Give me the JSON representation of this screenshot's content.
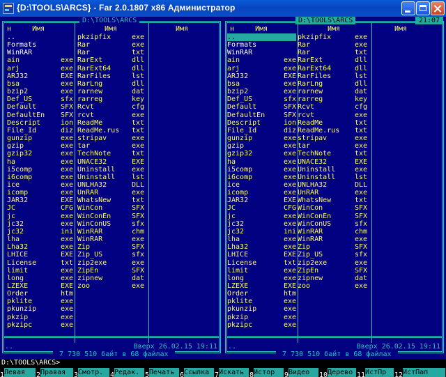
{
  "window": {
    "title": "{D:\\TOOLS\\ARCS} - Far 2.0.1807 x86 Администратор"
  },
  "clock": "21:07",
  "left_panel": {
    "path": " D:\\TOOLS\\ARCS ",
    "col1_header": "н     Имя",
    "col2_header": "Имя",
    "col3_header": "Имя",
    "status_name": "..",
    "status_info": "Вверх 26.02.15 19:11",
    "totals": " 7 730 510 байт в 68 файлах ",
    "columns": [
      [
        {
          "n": "..",
          "e": "",
          "t": "dir"
        },
        {
          "n": "Formats",
          "e": "",
          "t": "dir"
        },
        {
          "n": "WinRAR",
          "e": "",
          "t": "dir"
        },
        {
          "n": "ain",
          "e": "exe",
          "t": "f"
        },
        {
          "n": "arj",
          "e": "exe",
          "t": "f"
        },
        {
          "n": "ARJ32",
          "e": "EXE",
          "t": "f"
        },
        {
          "n": "bsa",
          "e": "exe",
          "t": "f"
        },
        {
          "n": "bzip2",
          "e": "exe",
          "t": "f"
        },
        {
          "n": "Def_US",
          "e": "sfx",
          "t": "f"
        },
        {
          "n": "Default",
          "e": "SFX",
          "t": "f"
        },
        {
          "n": "DefaultEn",
          "e": "SFX",
          "t": "f"
        },
        {
          "n": "Descript",
          "e": "ion",
          "t": "f"
        },
        {
          "n": "File_Id",
          "e": "diz",
          "t": "f"
        },
        {
          "n": "gunzip",
          "e": "exe",
          "t": "f"
        },
        {
          "n": "gzip",
          "e": "exe",
          "t": "f"
        },
        {
          "n": "gzip32",
          "e": "exe",
          "t": "f"
        },
        {
          "n": "ha",
          "e": "exe",
          "t": "f"
        },
        {
          "n": "i5comp",
          "e": "exe",
          "t": "f"
        },
        {
          "n": "i6comp",
          "e": "exe",
          "t": "f"
        },
        {
          "n": "ice",
          "e": "exe",
          "t": "f"
        },
        {
          "n": "icomp",
          "e": "exe",
          "t": "f"
        },
        {
          "n": "JAR32",
          "e": "EXE",
          "t": "f"
        },
        {
          "n": "JC",
          "e": "CFG",
          "t": "f"
        },
        {
          "n": "jc",
          "e": "exe",
          "t": "f"
        },
        {
          "n": "jc32",
          "e": "exe",
          "t": "f"
        },
        {
          "n": "jc32",
          "e": "ini",
          "t": "f"
        },
        {
          "n": "lha",
          "e": "exe",
          "t": "f"
        },
        {
          "n": "Lha32",
          "e": "exe",
          "t": "f"
        },
        {
          "n": "LHICE",
          "e": "EXE",
          "t": "f"
        },
        {
          "n": "License",
          "e": "txt",
          "t": "f"
        },
        {
          "n": "limit",
          "e": "exe",
          "t": "f"
        },
        {
          "n": "long",
          "e": "exe",
          "t": "f"
        },
        {
          "n": "LZEXE",
          "e": "EXE",
          "t": "f"
        },
        {
          "n": "Order",
          "e": "htm",
          "t": "f"
        },
        {
          "n": "pklite",
          "e": "exe",
          "t": "f"
        },
        {
          "n": "pkunzip",
          "e": "exe",
          "t": "f"
        },
        {
          "n": "pkzip",
          "e": "exe",
          "t": "f"
        },
        {
          "n": "pkzipc",
          "e": "exe",
          "t": "f"
        }
      ],
      [
        {
          "n": "pkzipfix",
          "e": "exe",
          "t": "f"
        },
        {
          "n": "Rar",
          "e": "exe",
          "t": "f"
        },
        {
          "n": "Rar",
          "e": "txt",
          "t": "f"
        },
        {
          "n": "RarExt",
          "e": "dll",
          "t": "f"
        },
        {
          "n": "RarExt64",
          "e": "dll",
          "t": "f"
        },
        {
          "n": "RarFiles",
          "e": "lst",
          "t": "f"
        },
        {
          "n": "RarLng",
          "e": "dll",
          "t": "f"
        },
        {
          "n": "rarnew",
          "e": "dat",
          "t": "f"
        },
        {
          "n": "rarreg",
          "e": "key",
          "t": "f"
        },
        {
          "n": "Rcvt",
          "e": "cfg",
          "t": "f"
        },
        {
          "n": "rcvt",
          "e": "exe",
          "t": "f"
        },
        {
          "n": "ReadMe",
          "e": "txt",
          "t": "f"
        },
        {
          "n": "ReadMe.rus",
          "e": "txt",
          "t": "f"
        },
        {
          "n": "stripav",
          "e": "exe",
          "t": "f"
        },
        {
          "n": "tar",
          "e": "exe",
          "t": "f"
        },
        {
          "n": "TechNote",
          "e": "txt",
          "t": "f"
        },
        {
          "n": "UNACE32",
          "e": "EXE",
          "t": "f"
        },
        {
          "n": "Uninstall",
          "e": "exe",
          "t": "f"
        },
        {
          "n": "Uninstall",
          "e": "lst",
          "t": "f"
        },
        {
          "n": "UNLHA32",
          "e": "DLL",
          "t": "f"
        },
        {
          "n": "UnRAR",
          "e": "exe",
          "t": "f"
        },
        {
          "n": "WhatsNew",
          "e": "txt",
          "t": "f"
        },
        {
          "n": "WinCon",
          "e": "SFX",
          "t": "f"
        },
        {
          "n": "WinConEn",
          "e": "SFX",
          "t": "f"
        },
        {
          "n": "WinConUS",
          "e": "sfx",
          "t": "f"
        },
        {
          "n": "WinRAR",
          "e": "chm",
          "t": "f"
        },
        {
          "n": "WinRAR",
          "e": "exe",
          "t": "f"
        },
        {
          "n": "Zip",
          "e": "SFX",
          "t": "f"
        },
        {
          "n": "Zip_US",
          "e": "sfx",
          "t": "f"
        },
        {
          "n": "zip2exe",
          "e": "exe",
          "t": "f"
        },
        {
          "n": "ZipEn",
          "e": "SFX",
          "t": "f"
        },
        {
          "n": "zipnew",
          "e": "dat",
          "t": "f"
        },
        {
          "n": "zoo",
          "e": "exe",
          "t": "f"
        }
      ],
      []
    ]
  },
  "right_panel": {
    "path": " D:\\TOOLS\\ARCS ",
    "col1_header": "н     Имя",
    "col2_header": "Имя",
    "col3_header": "Имя",
    "status_name": "..",
    "status_info": "Вверх 26.02.15 19:11",
    "totals": " 7 730 510 байт в 68 файлах ",
    "columns": [
      [
        {
          "n": "..",
          "e": "",
          "t": "cursor"
        },
        {
          "n": "Formats",
          "e": "",
          "t": "dir"
        },
        {
          "n": "WinRAR",
          "e": "",
          "t": "dir"
        },
        {
          "n": "ain",
          "e": "exe",
          "t": "f"
        },
        {
          "n": "arj",
          "e": "exe",
          "t": "f"
        },
        {
          "n": "ARJ32",
          "e": "EXE",
          "t": "f"
        },
        {
          "n": "bsa",
          "e": "exe",
          "t": "f"
        },
        {
          "n": "bzip2",
          "e": "exe",
          "t": "f"
        },
        {
          "n": "Def_US",
          "e": "sfx",
          "t": "f"
        },
        {
          "n": "Default",
          "e": "SFX",
          "t": "f"
        },
        {
          "n": "DefaultEn",
          "e": "SFX",
          "t": "f"
        },
        {
          "n": "Descript",
          "e": "ion",
          "t": "f"
        },
        {
          "n": "File_Id",
          "e": "diz",
          "t": "f"
        },
        {
          "n": "gunzip",
          "e": "exe",
          "t": "f"
        },
        {
          "n": "gzip",
          "e": "exe",
          "t": "f"
        },
        {
          "n": "gzip32",
          "e": "exe",
          "t": "f"
        },
        {
          "n": "ha",
          "e": "exe",
          "t": "f"
        },
        {
          "n": "i5comp",
          "e": "exe",
          "t": "f"
        },
        {
          "n": "i6comp",
          "e": "exe",
          "t": "f"
        },
        {
          "n": "ice",
          "e": "exe",
          "t": "f"
        },
        {
          "n": "icomp",
          "e": "exe",
          "t": "f"
        },
        {
          "n": "JAR32",
          "e": "EXE",
          "t": "f"
        },
        {
          "n": "JC",
          "e": "CFG",
          "t": "f"
        },
        {
          "n": "jc",
          "e": "exe",
          "t": "f"
        },
        {
          "n": "jc32",
          "e": "exe",
          "t": "f"
        },
        {
          "n": "jc32",
          "e": "ini",
          "t": "f"
        },
        {
          "n": "lha",
          "e": "exe",
          "t": "f"
        },
        {
          "n": "Lha32",
          "e": "exe",
          "t": "f"
        },
        {
          "n": "LHICE",
          "e": "EXE",
          "t": "f"
        },
        {
          "n": "License",
          "e": "txt",
          "t": "f"
        },
        {
          "n": "limit",
          "e": "exe",
          "t": "f"
        },
        {
          "n": "long",
          "e": "exe",
          "t": "f"
        },
        {
          "n": "LZEXE",
          "e": "EXE",
          "t": "f"
        },
        {
          "n": "Order",
          "e": "htm",
          "t": "f"
        },
        {
          "n": "pklite",
          "e": "exe",
          "t": "f"
        },
        {
          "n": "pkunzip",
          "e": "exe",
          "t": "f"
        },
        {
          "n": "pkzip",
          "e": "exe",
          "t": "f"
        },
        {
          "n": "pkzipc",
          "e": "exe",
          "t": "f"
        }
      ],
      [
        {
          "n": "pkzipfix",
          "e": "exe",
          "t": "f"
        },
        {
          "n": "Rar",
          "e": "exe",
          "t": "f"
        },
        {
          "n": "Rar",
          "e": "txt",
          "t": "f"
        },
        {
          "n": "RarExt",
          "e": "dll",
          "t": "f"
        },
        {
          "n": "RarExt64",
          "e": "dll",
          "t": "f"
        },
        {
          "n": "RarFiles",
          "e": "lst",
          "t": "f"
        },
        {
          "n": "RarLng",
          "e": "dll",
          "t": "f"
        },
        {
          "n": "rarnew",
          "e": "dat",
          "t": "f"
        },
        {
          "n": "rarreg",
          "e": "key",
          "t": "f"
        },
        {
          "n": "Rcvt",
          "e": "cfg",
          "t": "f"
        },
        {
          "n": "rcvt",
          "e": "exe",
          "t": "f"
        },
        {
          "n": "ReadMe",
          "e": "txt",
          "t": "f"
        },
        {
          "n": "ReadMe.rus",
          "e": "txt",
          "t": "f"
        },
        {
          "n": "stripav",
          "e": "exe",
          "t": "f"
        },
        {
          "n": "tar",
          "e": "exe",
          "t": "f"
        },
        {
          "n": "TechNote",
          "e": "txt",
          "t": "f"
        },
        {
          "n": "UNACE32",
          "e": "EXE",
          "t": "f"
        },
        {
          "n": "Uninstall",
          "e": "exe",
          "t": "f"
        },
        {
          "n": "Uninstall",
          "e": "lst",
          "t": "f"
        },
        {
          "n": "UNLHA32",
          "e": "DLL",
          "t": "f"
        },
        {
          "n": "UnRAR",
          "e": "exe",
          "t": "f"
        },
        {
          "n": "WhatsNew",
          "e": "txt",
          "t": "f"
        },
        {
          "n": "WinCon",
          "e": "SFX",
          "t": "f"
        },
        {
          "n": "WinConEn",
          "e": "SFX",
          "t": "f"
        },
        {
          "n": "WinConUS",
          "e": "sfx",
          "t": "f"
        },
        {
          "n": "WinRAR",
          "e": "chm",
          "t": "f"
        },
        {
          "n": "WinRAR",
          "e": "exe",
          "t": "f"
        },
        {
          "n": "Zip",
          "e": "SFX",
          "t": "f"
        },
        {
          "n": "Zip_US",
          "e": "sfx",
          "t": "f"
        },
        {
          "n": "zip2exe",
          "e": "exe",
          "t": "f"
        },
        {
          "n": "ZipEn",
          "e": "SFX",
          "t": "f"
        },
        {
          "n": "zipnew",
          "e": "dat",
          "t": "f"
        },
        {
          "n": "zoo",
          "e": "exe",
          "t": "f"
        }
      ],
      []
    ]
  },
  "selected_names": [
    "ain",
    "arj",
    "ARJ32",
    "bsa",
    "bzip2",
    "Def_US",
    "Default",
    "DefaultEn",
    "Descript",
    "File_Id",
    "gunzip",
    "gzip",
    "gzip32",
    "ha",
    "i5comp",
    "i6comp",
    "ice",
    "icomp",
    "JAR32",
    "JC",
    "jc",
    "jc32",
    "lha",
    "Lha32",
    "LHICE",
    "License",
    "limit",
    "long",
    "LZEXE",
    "Order",
    "pklite",
    "pkunzip",
    "pkzip",
    "pkzipc",
    "pkzipfix",
    "Rar",
    "RarExt",
    "RarExt64",
    "RarFiles",
    "RarLng",
    "rarnew",
    "rarreg",
    "Rcvt",
    "rcvt",
    "ReadMe",
    "ReadMe.rus",
    "stripav",
    "tar",
    "TechNote",
    "UNACE32",
    "Uninstall",
    "UNLHA32",
    "UnRAR",
    "WhatsNew",
    "WinCon",
    "WinConEn",
    "WinConUS",
    "WinRAR",
    "Zip",
    "Zip_US",
    "zip2exe",
    "ZipEn",
    "zipnew",
    "zoo"
  ],
  "cmdline": "D:\\TOOLS\\ARCS>",
  "keybar": [
    {
      "num": "1",
      "label": "Левая"
    },
    {
      "num": "2",
      "label": "Правая"
    },
    {
      "num": "3",
      "label": "Смотр."
    },
    {
      "num": "4",
      "label": "Редак."
    },
    {
      "num": "5",
      "label": "Печать"
    },
    {
      "num": "6",
      "label": "Ссылка"
    },
    {
      "num": "7",
      "label": "Искать"
    },
    {
      "num": "8",
      "label": "Истор"
    },
    {
      "num": "9",
      "label": "Видео"
    },
    {
      "num": "10",
      "label": "Дерево"
    },
    {
      "num": "11",
      "label": "ИстПр"
    },
    {
      "num": "12",
      "label": "ИстПап"
    }
  ],
  "colors": {
    "panel_bg": "#000080",
    "frame": "#26c3c3",
    "text": "#26c3c3",
    "header": "#ffff55",
    "cursor_bg": "#26a9a0",
    "titlebar": "#0846c0"
  }
}
